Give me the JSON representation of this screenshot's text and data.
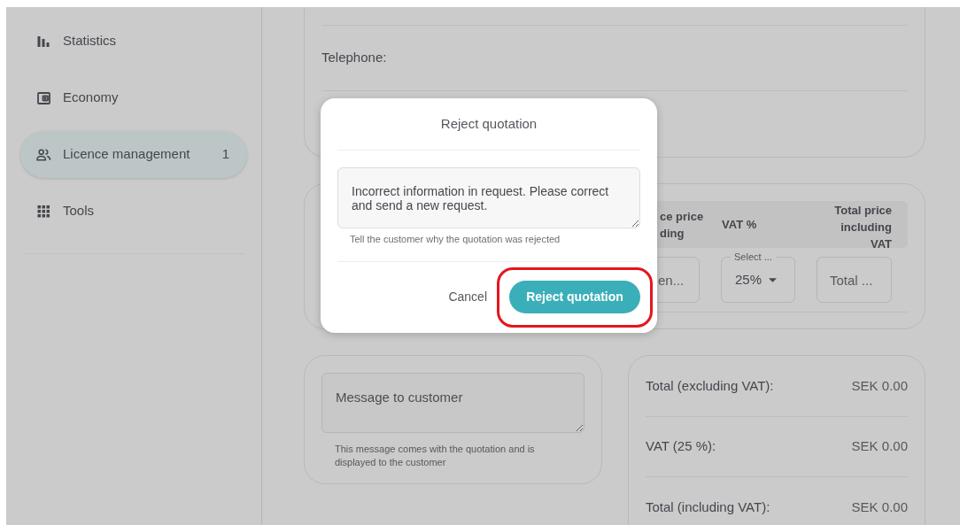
{
  "sidebar": {
    "items": [
      {
        "label": "Statistics",
        "selected": false
      },
      {
        "label": "Economy",
        "selected": false
      },
      {
        "label": "Licence management",
        "badge": "1",
        "selected": true
      },
      {
        "label": "Tools",
        "selected": false
      }
    ]
  },
  "contact_card": {
    "telephone_label": "Telephone:"
  },
  "lines_card": {
    "columns": [
      "ce price ding",
      "VAT %",
      "Total price including VAT"
    ],
    "fields": [
      {
        "kind": "text",
        "placeholder": "en..."
      },
      {
        "kind": "select",
        "label": "Select ...",
        "value": "25%"
      },
      {
        "kind": "text",
        "placeholder": "Total ..."
      }
    ]
  },
  "message_card": {
    "placeholder": "Message to customer",
    "helper": "This message comes with the quotation and is displayed to the customer"
  },
  "totals": [
    {
      "label": "Total (excluding VAT):",
      "value": "SEK 0.00"
    },
    {
      "label": "VAT (25 %):",
      "value": "SEK 0.00"
    },
    {
      "label": "Total (including VAT):",
      "value": "SEK 0.00"
    }
  ],
  "dialog": {
    "title": "Reject quotation",
    "reason": "Incorrect information in request. Please correct and send a new request.",
    "helper": "Tell the customer why the quotation was rejected",
    "cancel": "Cancel",
    "confirm": "Reject quotation",
    "highlighted": true
  }
}
